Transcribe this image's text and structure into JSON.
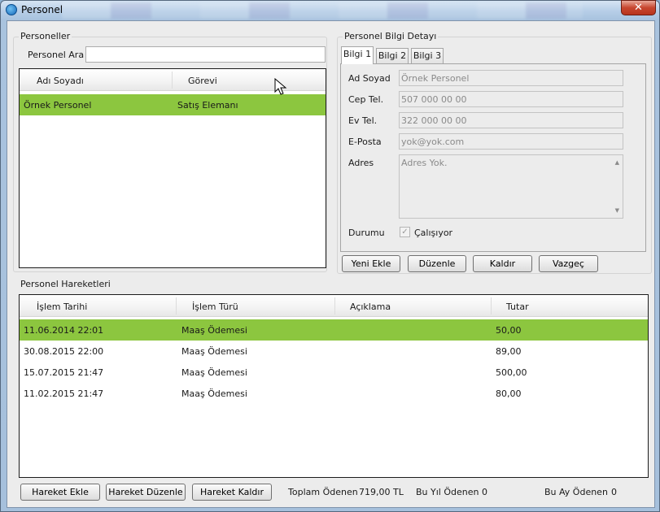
{
  "window": {
    "title": "Personel",
    "close_glyph": "✕"
  },
  "personeller": {
    "title": "Personeller",
    "search_label": "Personel Ara",
    "search_value": "",
    "columns": [
      "Adı Soyadı",
      "Görevi"
    ],
    "rows": [
      {
        "ad": "Örnek Personel",
        "gorev": "Satış Elemanı",
        "selected": true
      }
    ]
  },
  "detay": {
    "title": "Personel Bilgi Detayı",
    "tabs": [
      "Bilgi 1",
      "Bilgi 2",
      "Bilgi 3"
    ],
    "active_tab": "Bilgi 1",
    "fields": {
      "ad_label": "Ad Soyad",
      "ad_value": "Örnek Personel",
      "cep_label": "Cep Tel.",
      "cep_value": "507 000 00 00",
      "ev_label": "Ev Tel.",
      "ev_value": "322 000 00 00",
      "eposta_label": "E-Posta",
      "eposta_value": "yok@yok.com",
      "adres_label": "Adres",
      "adres_value": "Adres Yok.",
      "durum_label": "Durumu",
      "durum_check_label": "Çalışıyor",
      "durum_checked": true
    },
    "buttons": {
      "yeni": "Yeni Ekle",
      "duzenle": "Düzenle",
      "kaldir": "Kaldır",
      "vazgec": "Vazgeç"
    }
  },
  "hareketler": {
    "title": "Personel Hareketleri",
    "columns": [
      "İşlem Tarihi",
      "İşlem Türü",
      "Açıklama",
      "Tutar"
    ],
    "rows": [
      {
        "tarih": "11.06.2014 22:01",
        "tur": "Maaş Ödemesi",
        "aciklama": "",
        "tutar": "50,00",
        "selected": true
      },
      {
        "tarih": "30.08.2015 22:00",
        "tur": "Maaş Ödemesi",
        "aciklama": "",
        "tutar": "89,00",
        "selected": false
      },
      {
        "tarih": "15.07.2015 21:47",
        "tur": "Maaş Ödemesi",
        "aciklama": "",
        "tutar": "500,00",
        "selected": false
      },
      {
        "tarih": "11.02.2015 21:47",
        "tur": "Maaş Ödemesi",
        "aciklama": "",
        "tutar": "80,00",
        "selected": false
      }
    ]
  },
  "footer": {
    "hareket_ekle": "Hareket Ekle",
    "hareket_duzenle": "Hareket Düzenle",
    "hareket_kaldir": "Hareket Kaldır",
    "toplam_label": "Toplam Ödenen",
    "toplam_value": "719,00 TL",
    "bu_yil_label": "Bu Yıl Ödenen",
    "bu_yil_value": "0",
    "bu_ay_label": "Bu Ay Ödenen",
    "bu_ay_value": "0"
  },
  "colors": {
    "selection": "#8cc63f"
  }
}
